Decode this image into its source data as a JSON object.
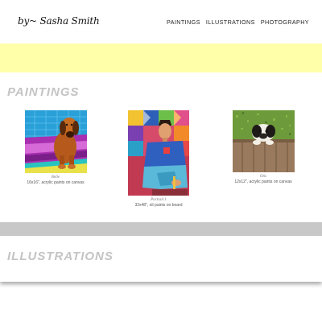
{
  "header": {
    "logo_text": "by~ Sasha Smith",
    "nav": [
      {
        "label": "PAINTINGS"
      },
      {
        "label": "ILLUSTRATIONS"
      },
      {
        "label": "PHOTOGRAPHY"
      }
    ]
  },
  "sections": {
    "paintings": "PAINTINGS",
    "illustrations": "ILLUSTRATIONS"
  },
  "gallery": [
    {
      "title": "Belle",
      "description": "16x16\", acrylic paints on canvas"
    },
    {
      "title": "Portrait 1",
      "description": "32x48\", oil paints on board"
    },
    {
      "title": "Otis",
      "description": "12x12\", acrylic paints on canvas"
    }
  ],
  "colors": {
    "banner": "#ffffaa",
    "section_title": "#c4c4c4",
    "gray_band": "#c8c8c8"
  }
}
